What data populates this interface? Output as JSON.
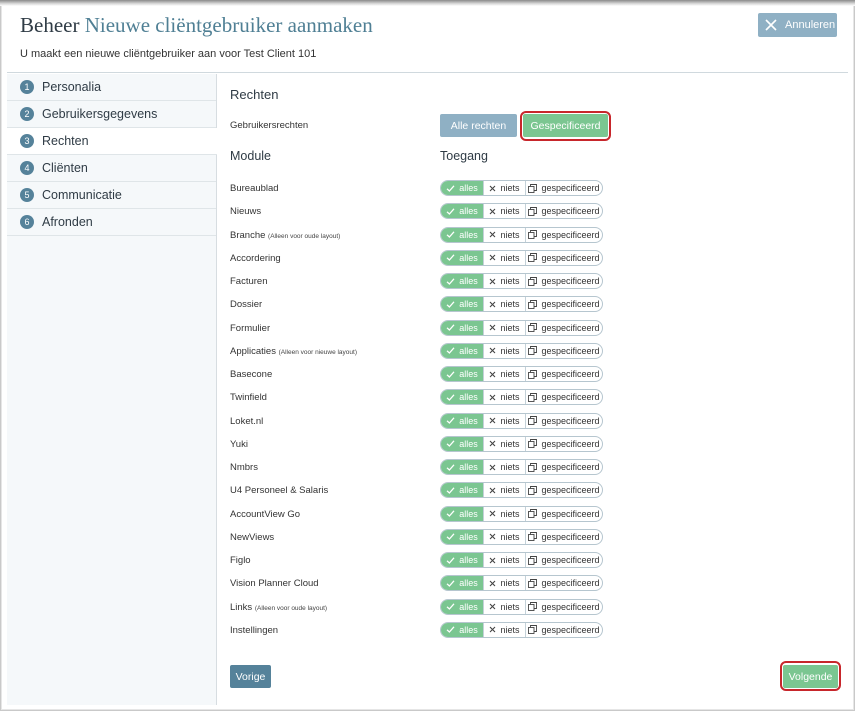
{
  "header": {
    "title_prefix": "Beheer",
    "title_main": "Nieuwe cliëntgebruiker aanmaken",
    "subtitle": "U maakt een nieuwe cliëntgebruiker aan voor Test Client 101",
    "cancel_label": "Annuleren"
  },
  "sidebar": {
    "items": [
      {
        "num": "1",
        "label": "Personalia"
      },
      {
        "num": "2",
        "label": "Gebruikersgegevens"
      },
      {
        "num": "3",
        "label": "Rechten"
      },
      {
        "num": "4",
        "label": "Cliënten"
      },
      {
        "num": "5",
        "label": "Communicatie"
      },
      {
        "num": "6",
        "label": "Afronden"
      }
    ]
  },
  "content": {
    "section_title": "Rechten",
    "rights_label": "Gebruikersrechten",
    "btn_all": "Alle rechten",
    "btn_specified": "Gespecificeerd",
    "col_module": "Module",
    "col_access": "Toegang",
    "toggle": {
      "all": "alles",
      "none": "niets",
      "specified": "gespecificeerd"
    },
    "modules": [
      {
        "name": "Bureaublad",
        "note": ""
      },
      {
        "name": "Nieuws",
        "note": ""
      },
      {
        "name": "Branche",
        "note": "(Alleen voor oude layout)"
      },
      {
        "name": "Accordering",
        "note": ""
      },
      {
        "name": "Facturen",
        "note": ""
      },
      {
        "name": "Dossier",
        "note": ""
      },
      {
        "name": "Formulier",
        "note": ""
      },
      {
        "name": "Applicaties",
        "note": "(Alleen voor nieuwe layout)"
      },
      {
        "name": "Basecone",
        "note": ""
      },
      {
        "name": "Twinfield",
        "note": ""
      },
      {
        "name": "Loket.nl",
        "note": ""
      },
      {
        "name": "Yuki",
        "note": ""
      },
      {
        "name": "Nmbrs",
        "note": ""
      },
      {
        "name": "U4 Personeel & Salaris",
        "note": ""
      },
      {
        "name": "AccountView Go",
        "note": ""
      },
      {
        "name": "NewViews",
        "note": ""
      },
      {
        "name": "Figlo",
        "note": ""
      },
      {
        "name": "Vision Planner Cloud",
        "note": ""
      },
      {
        "name": "Links",
        "note": "(Alleen voor oude layout)"
      },
      {
        "name": "Instellingen",
        "note": ""
      }
    ]
  },
  "footer": {
    "prev_label": "Vorige",
    "next_label": "Volgende"
  },
  "colors": {
    "accent_green": "#7bc691",
    "accent_blue": "#55829a",
    "highlight_red": "#c7262b"
  }
}
